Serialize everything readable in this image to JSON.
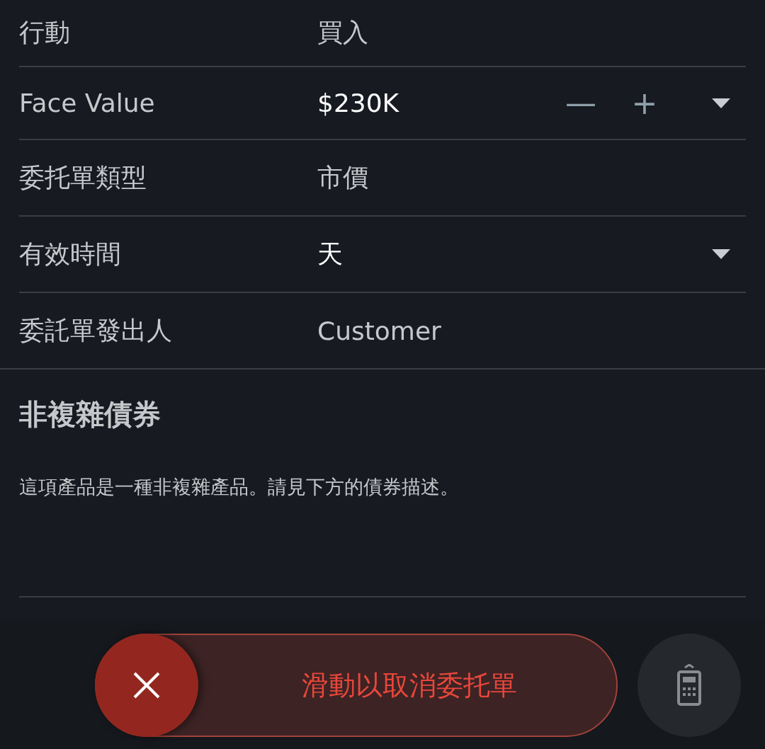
{
  "order_fields": [
    {
      "label": "行動",
      "value": "買入",
      "kind": "text"
    },
    {
      "label": "Face Value",
      "value": "$230K",
      "kind": "stepper",
      "decrease": "—",
      "increase": "+"
    },
    {
      "label": "委托單類型",
      "value": "市價",
      "kind": "text"
    },
    {
      "label": "有效時間",
      "value": "天",
      "kind": "select"
    },
    {
      "label": "委託單發出人",
      "value": "Customer",
      "kind": "text"
    }
  ],
  "section": {
    "title": "非複雜債券",
    "description": "這項產品是一種非複雜產品。請見下方的債券描述。"
  },
  "slider": {
    "label": "滑動以取消委托單"
  }
}
